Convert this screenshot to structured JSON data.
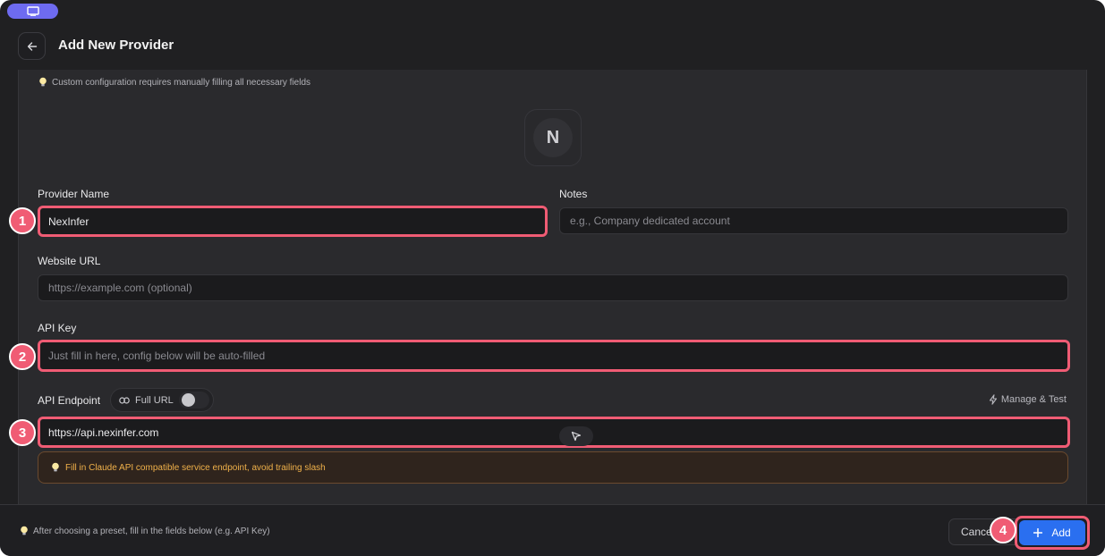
{
  "header": {
    "title": "Add New Provider"
  },
  "hint_top": "Custom configuration requires manually filling all necessary fields",
  "avatar_letter": "N",
  "form": {
    "provider_name": {
      "label": "Provider Name",
      "value": "NexInfer"
    },
    "notes": {
      "label": "Notes",
      "placeholder": "e.g., Company dedicated account"
    },
    "website": {
      "label": "Website URL",
      "placeholder": "https://example.com (optional)"
    },
    "api_key": {
      "label": "API Key",
      "placeholder": "Just fill in here, config below will be auto-filled"
    },
    "endpoint": {
      "label": "API Endpoint",
      "toggle_label": "Full URL",
      "toggle_on": false,
      "manage_label": "Manage & Test",
      "value": "https://api.nexinfer.com",
      "warning": "Fill in Claude API compatible service endpoint, avoid trailing slash"
    }
  },
  "footer": {
    "hint": "After choosing a preset, fill in the fields below (e.g. API Key)",
    "cancel_label": "Cancel",
    "add_label": "Add"
  },
  "callouts": [
    "1",
    "2",
    "3",
    "4"
  ],
  "colors": {
    "accent": "#2a6ff0",
    "highlight": "#f05c74",
    "warning": "#f0b14a",
    "pill": "#6e6bf0"
  }
}
